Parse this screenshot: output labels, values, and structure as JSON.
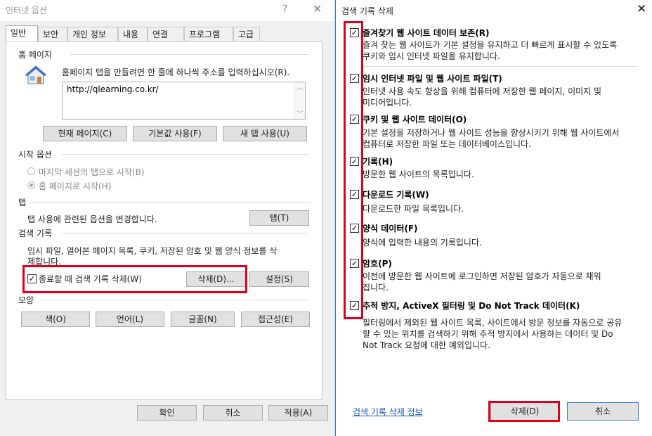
{
  "internet_options": {
    "title": "인터넷 옵션",
    "help_glyph": "?",
    "close_glyph": "✕",
    "tabs": [
      "일반",
      "보안",
      "개인 정보",
      "내용",
      "연결",
      "프로그램",
      "고급"
    ],
    "home_page": {
      "label": "홈 페이지",
      "description": "홈페이지 탭을 만들려면 한 줄에 하나씩 주소를 입력하십시오(R).",
      "url": "http://qlearning.co.kr/",
      "btn_current": "현재 페이지(C)",
      "btn_default": "기본값 사용(F)",
      "btn_newtab": "새 탭 사용(U)"
    },
    "startup": {
      "label": "시작 옵션",
      "option1": "마지막 세션의 탭으로 시작(B)",
      "option2": "홈 페이지로 시작(H)"
    },
    "tabs_section": {
      "label": "탭",
      "description": "탭 사용에 관련된 옵션을 변경합니다.",
      "btn": "탭(T)"
    },
    "history": {
      "label": "검색 기록",
      "description_line1": "임시 파일, 열어본 페이지 목록, 쿠키, 저장된 암호 및 웹 양식 정보를 삭",
      "description_line2": "제합니다.",
      "checkbox_label": "종료할 때 검색 기록 삭제(W)",
      "checkbox_checked": true,
      "btn_delete": "삭제(D)...",
      "btn_settings": "설정(S)"
    },
    "appearance": {
      "label": "모양",
      "btn_colors": "색(O)",
      "btn_languages": "언어(L)",
      "btn_fonts": "글꼴(N)",
      "btn_accessibility": "접근성(E)"
    },
    "footer": {
      "ok": "확인",
      "cancel": "취소",
      "apply": "적용(A)"
    }
  },
  "delete_history": {
    "title": "검색 기록 삭제",
    "close_glyph": "✕",
    "options": [
      {
        "title": "즐겨찾기 웹 사이트 데이터 보존(R)",
        "desc": [
          "즐겨 찾는 웹 사이트가 기본 설정을 유지하고 더 빠르게 표시할 수 있도록",
          "쿠키와 임시 인터넷 파일을 유지합니다."
        ],
        "checked": true
      },
      {
        "title": "임시 인터넷 파일 및 웹 사이트 파일(T)",
        "desc": [
          "인터넷 사용 속도 향상을 위해 컴퓨터에 저장한 웹 페이지, 이미지 및",
          "미디어입니다."
        ],
        "checked": true
      },
      {
        "title": "쿠키 및 웹 사이트 데이터(O)",
        "desc": [
          "기본 설정을 저장하거나 웹 사이트 성능을 향상시키기 위해 웹 사이트에서",
          "컴퓨터로 저장한 파일 또는 데이터베이스입니다."
        ],
        "checked": true
      },
      {
        "title": "기록(H)",
        "desc": [
          "방문한 웹 사이트의 목록입니다."
        ],
        "checked": true
      },
      {
        "title": "다운로드 기록(W)",
        "desc": [
          "다운로드한 파일 목록입니다."
        ],
        "checked": true
      },
      {
        "title": "양식 데이터(F)",
        "desc": [
          "양식에 입력한 내용의 기록입니다."
        ],
        "checked": true
      },
      {
        "title": "암호(P)",
        "desc": [
          "이전에 방문한 웹 사이트에 로그인하면 저장된 암호가 자동으로 채워",
          "집니다."
        ],
        "checked": true
      },
      {
        "title": "추적 방지, ActiveX 필터링 및 Do Not Track 데이터(K)",
        "desc": [
          "필터링에서 제외된 웹 사이트 목록, 사이트에서 방문 정보를 자동으로 공유",
          "할 수 있는 위치를 검색하기 위해 추적 방지에서 사용하는 데이터 및 Do",
          "Not Track 요청에 대한 예외입니다."
        ],
        "checked": true
      }
    ],
    "info_link": "검색 기록 삭제 정보",
    "btn_delete": "삭제(D)",
    "btn_cancel": "취소"
  }
}
